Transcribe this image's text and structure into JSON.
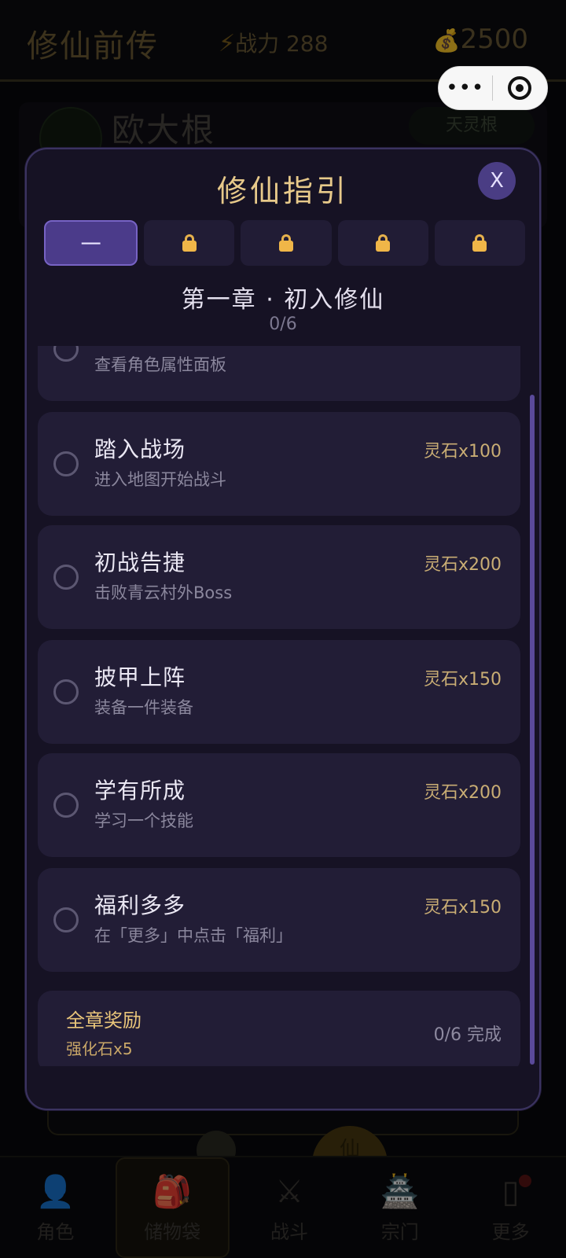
{
  "background": {
    "game_title": "修仙前传",
    "power_icon": "⚡",
    "power_label": "战力 288",
    "gold_icon": "💰",
    "gold_value": "2500",
    "player_name": "欧大根",
    "root_badge": "天灵根",
    "bottom_orb": "仙",
    "tabs": [
      {
        "icon": "👤",
        "label": "角色"
      },
      {
        "icon": "🎒",
        "label": "储物袋"
      },
      {
        "icon": "⚔",
        "label": "战斗"
      },
      {
        "icon": "🏯",
        "label": "宗门"
      },
      {
        "icon": "▯",
        "label": "更多"
      }
    ]
  },
  "miniprogram_capsule": {
    "more": "•••"
  },
  "modal": {
    "title": "修仙指引",
    "close_label": "X",
    "chapter_tabs": [
      {
        "label": "一",
        "locked": false
      },
      {
        "label": "",
        "locked": true
      },
      {
        "label": "",
        "locked": true
      },
      {
        "label": "",
        "locked": true
      },
      {
        "label": "",
        "locked": true
      }
    ],
    "chapter_name": "第一章 · 初入修仙",
    "chapter_progress": "0/6",
    "tasks": [
      {
        "title": "",
        "desc": "查看角色属性面板",
        "reward": ""
      },
      {
        "title": "踏入战场",
        "desc": "进入地图开始战斗",
        "reward": "灵石x100"
      },
      {
        "title": "初战告捷",
        "desc": "击败青云村外Boss",
        "reward": "灵石x200"
      },
      {
        "title": "披甲上阵",
        "desc": "装备一件装备",
        "reward": "灵石x150"
      },
      {
        "title": "学有所成",
        "desc": "学习一个技能",
        "reward": "灵石x200"
      },
      {
        "title": "福利多多",
        "desc": "在「更多」中点击「福利」",
        "reward": "灵石x150"
      }
    ],
    "summary": {
      "title": "全章奖励",
      "reward": "强化石x5",
      "status": "0/6 完成"
    }
  }
}
